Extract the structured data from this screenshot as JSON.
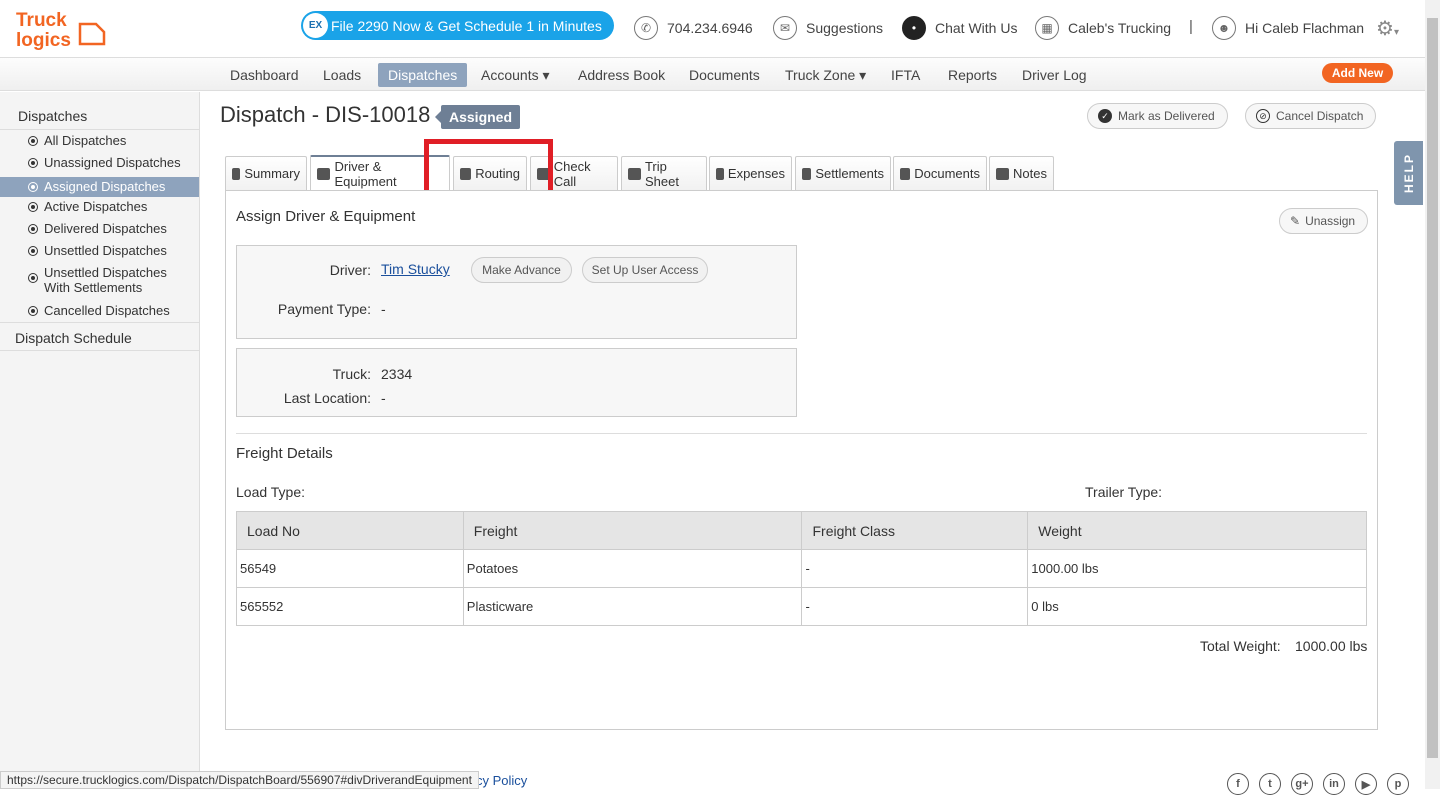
{
  "header": {
    "logo_line1": "Truck",
    "logo_line2": "logics",
    "promo_badge": "EX",
    "promo_text": "File 2290 Now & Get Schedule 1 in Minutes",
    "phone": "704.234.6946",
    "suggestions": "Suggestions",
    "chat": "Chat With Us",
    "company": "Caleb's Trucking",
    "separator": "|",
    "greeting": "Hi Caleb Flachman"
  },
  "nav": {
    "items": [
      "Dashboard",
      "Loads",
      "Dispatches",
      "Accounts ▾",
      "Address Book",
      "Documents",
      "Truck Zone ▾",
      "IFTA",
      "Reports",
      "Driver Log"
    ],
    "add_new": "Add New"
  },
  "sidebar": {
    "heading": "Dispatches",
    "items": [
      "All Dispatches",
      "Unassigned Dispatches",
      "Assigned Dispatches",
      "Active Dispatches",
      "Delivered Dispatches",
      "Unsettled Dispatches",
      "Unsettled Dispatches With Settlements",
      "Cancelled Dispatches"
    ],
    "schedule": "Dispatch Schedule"
  },
  "page": {
    "title": "Dispatch - DIS-10018",
    "status": "Assigned",
    "mark_delivered": "Mark as Delivered",
    "cancel_dispatch": "Cancel Dispatch"
  },
  "tabs": [
    "Summary",
    "Driver & Equipment",
    "Routing",
    "Check Call",
    "Trip Sheet",
    "Expenses",
    "Settlements",
    "Documents",
    "Notes"
  ],
  "assign": {
    "title": "Assign Driver & Equipment",
    "unassign": "Unassign",
    "driver_label": "Driver:",
    "driver_name": "Tim Stucky",
    "make_advance": "Make Advance",
    "user_access": "Set Up User Access",
    "payment_label": "Payment Type:",
    "payment_value": "-",
    "truck_label": "Truck:",
    "truck_value": "2334",
    "location_label": "Last Location:",
    "location_value": "-"
  },
  "freight": {
    "title": "Freight Details",
    "load_type_label": "Load Type:",
    "trailer_type_label": "Trailer Type:",
    "columns": [
      "Load No",
      "Freight",
      "Freight Class",
      "Weight"
    ],
    "rows": [
      [
        "56549",
        "Potatoes",
        "-",
        "1000.00 lbs"
      ],
      [
        "565552",
        "Plasticware",
        "-",
        "0 lbs"
      ]
    ],
    "total_label": "Total Weight:",
    "total_value": "1000.00 lbs"
  },
  "help": "HELP",
  "footer": {
    "status_url": "https://secure.trucklogics.com/Dispatch/DispatchBoard/556907#divDriverandEquipment",
    "policy": "cy Policy",
    "social": [
      "f",
      "t",
      "g+",
      "in",
      "▶",
      "p"
    ]
  },
  "colors": {
    "accent_orange": "#f26522",
    "nav_active": "#8ea3bd",
    "promo_blue": "#1aa3e8",
    "highlight_red": "#e01e26"
  }
}
